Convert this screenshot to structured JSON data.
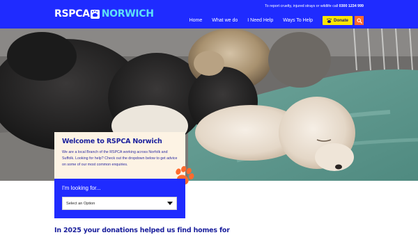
{
  "brand": {
    "name_part1": "RSPCA",
    "name_part2": "NORWICH"
  },
  "header": {
    "report_text": "To report cruelty, injured strays or wildlife call",
    "report_phone": "0300 1234 999",
    "nav": [
      "Home",
      "What we do",
      "I Need Help",
      "Ways To Help"
    ],
    "donate_label": "Donate",
    "search_icon": "search-icon"
  },
  "welcome": {
    "title": "Welcome to RSPCA Norwich",
    "body": "We are a local Branch of the RSPCA working across Norfolk and Suffolk. Looking for help? Check out the dropdown below to get advice on some of our most common enquiries."
  },
  "looking_for": {
    "heading": "I'm looking for...",
    "select_value": "Select an Option"
  },
  "donations_heading": "In 2025 your donations helped us find homes for",
  "colors": {
    "brand_blue": "#1f2bff",
    "accent_cyan": "#5ee0f7",
    "donate_yellow": "#ffe600",
    "search_orange": "#ff6b2d",
    "card_cream": "#fdf3e4"
  }
}
